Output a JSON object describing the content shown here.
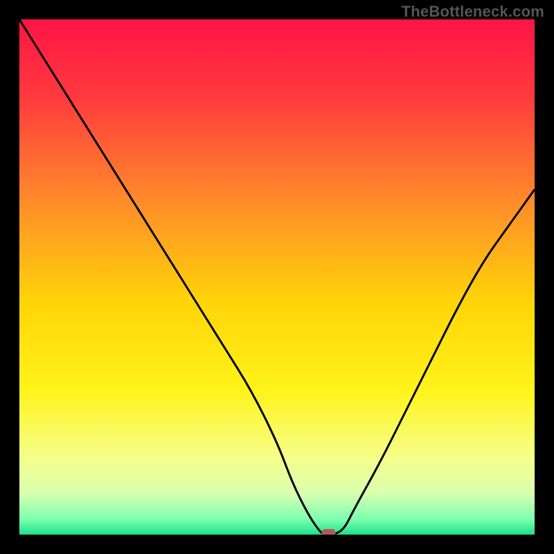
{
  "watermark": "TheBottleneck.com",
  "colors": {
    "frame": "#000000",
    "gradient_stops": [
      {
        "offset": 0.0,
        "color": "#ff1446"
      },
      {
        "offset": 0.15,
        "color": "#ff3a3e"
      },
      {
        "offset": 0.35,
        "color": "#ff8a2b"
      },
      {
        "offset": 0.55,
        "color": "#ffd508"
      },
      {
        "offset": 0.72,
        "color": "#fff31a"
      },
      {
        "offset": 0.85,
        "color": "#f5ff8a"
      },
      {
        "offset": 0.92,
        "color": "#d9ffb0"
      },
      {
        "offset": 0.97,
        "color": "#7dffb0"
      },
      {
        "offset": 1.0,
        "color": "#1ee08a"
      }
    ],
    "curve": "#000000",
    "marker": "#b25a5a"
  },
  "chart_data": {
    "type": "line",
    "title": "",
    "xlabel": "",
    "ylabel": "",
    "xlim": [
      0,
      100
    ],
    "ylim": [
      0,
      100
    ],
    "grid": false,
    "legend": false,
    "x": [
      0,
      5,
      10,
      15,
      20,
      25,
      30,
      35,
      40,
      45,
      50,
      53,
      56,
      58,
      59,
      60,
      61,
      63,
      65,
      70,
      75,
      80,
      85,
      90,
      95,
      100
    ],
    "values": [
      100,
      92,
      84,
      76,
      68,
      60,
      52,
      44,
      36,
      28,
      18,
      10,
      4,
      1,
      0,
      0,
      0,
      1,
      5,
      14,
      24,
      34,
      44,
      53,
      60,
      67
    ],
    "marker": {
      "x": 60,
      "y": 0
    },
    "annotations": []
  }
}
